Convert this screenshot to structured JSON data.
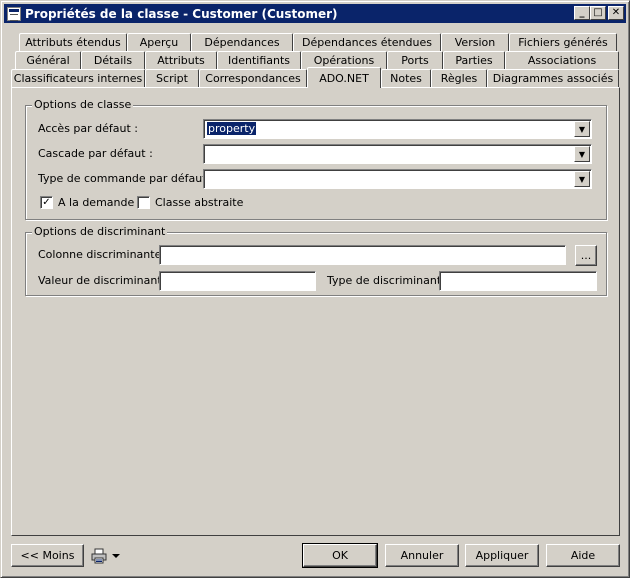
{
  "window": {
    "title": "Propriétés de la classe - Customer (Customer)"
  },
  "titlebar_buttons": {
    "minimize": "_",
    "maximize": "□",
    "close": "✕"
  },
  "tabs_row1": [
    "Attributs étendus",
    "Aperçu",
    "Dépendances",
    "Dépendances étendues",
    "Version",
    "Fichiers générés"
  ],
  "tabs_row2": [
    "Général",
    "Détails",
    "Attributs",
    "Identifiants",
    "Opérations",
    "Ports",
    "Parties",
    "Associations"
  ],
  "tabs_row3": [
    "Classificateurs internes",
    "Script",
    "Correspondances",
    "ADO.NET",
    "Notes",
    "Règles",
    "Diagrammes associés"
  ],
  "class_options": {
    "title": "Options de classe",
    "access_label": "Accès par défaut :",
    "access_value": "property",
    "cascade_label": "Cascade par défaut :",
    "cascade_value": "",
    "command_type_label": "Type de commande par défaut :",
    "command_type_value": "",
    "lazy_label": "A la demande",
    "lazy_checked": true,
    "abstract_label": "Classe abstraite",
    "abstract_checked": false
  },
  "discriminator_options": {
    "title": "Options de discriminant",
    "column_label": "Colonne discriminante :",
    "column_value": "",
    "browse_label": "...",
    "value_label": "Valeur de discriminant :",
    "value_value": "",
    "type_label": "Type de discriminant :",
    "type_value": ""
  },
  "footer": {
    "less_label": "<< Moins",
    "ok_label": "OK",
    "cancel_label": "Annuler",
    "apply_label": "Appliquer",
    "help_label": "Aide"
  },
  "colors": {
    "titlebar": "#0a246a",
    "face": "#d4d0c8",
    "selection": "#0a246a"
  },
  "icons": [
    "window-icon",
    "print-icon",
    "dropdown-arrow-icon",
    "check-icon"
  ]
}
